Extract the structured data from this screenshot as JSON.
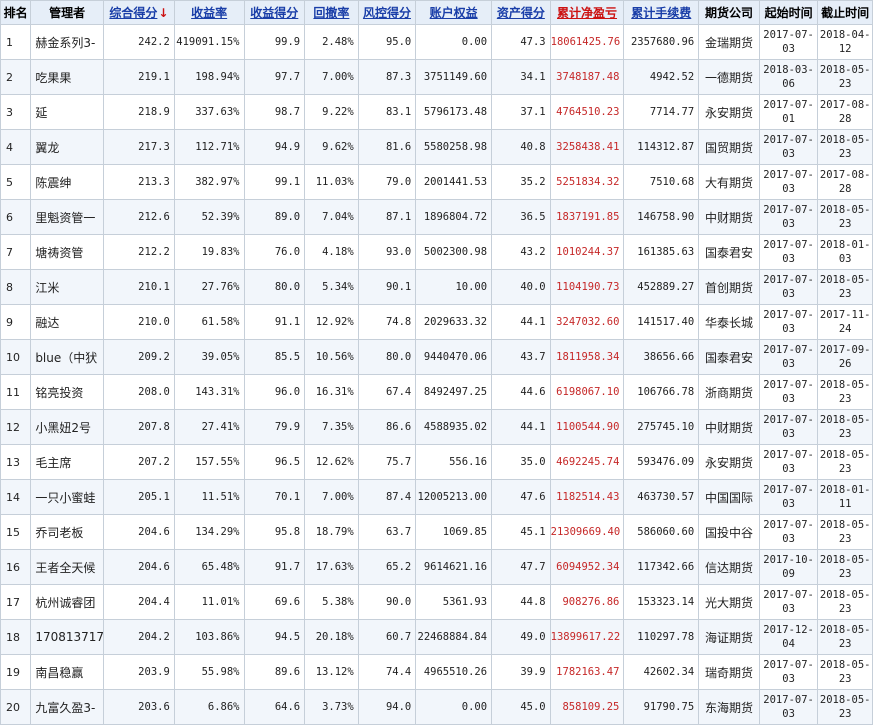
{
  "table": {
    "headers": [
      {
        "label": "排名",
        "link": false
      },
      {
        "label": "管理者",
        "link": false
      },
      {
        "label": "综合得分",
        "link": true,
        "sorted": true,
        "sort_icon": "↓"
      },
      {
        "label": "收益率",
        "link": true
      },
      {
        "label": "收益得分",
        "link": true
      },
      {
        "label": "回撤率",
        "link": true
      },
      {
        "label": "风控得分",
        "link": true
      },
      {
        "label": "账户权益",
        "link": true
      },
      {
        "label": "资产得分",
        "link": true
      },
      {
        "label": "累计净盈亏",
        "link": true,
        "color": "red"
      },
      {
        "label": "累计手续费",
        "link": true
      },
      {
        "label": "期货公司",
        "link": false
      },
      {
        "label": "起始时间",
        "link": false
      },
      {
        "label": "截止时间",
        "link": false
      }
    ],
    "rows": [
      {
        "rank": "1",
        "manager": "赫金系列3-",
        "score": "242.2",
        "return_rate": "419091.15%",
        "return_score": "99.9",
        "drawdown": "2.48%",
        "risk_score": "95.0",
        "equity": "0.00",
        "asset_score": "47.3",
        "net_profit": "18061425.76",
        "fees": "2357680.96",
        "company": "金瑞期货",
        "start_date": "2017-07-03",
        "end_date": "2018-04-12"
      },
      {
        "rank": "2",
        "manager": "吃果果",
        "score": "219.1",
        "return_rate": "198.94%",
        "return_score": "97.7",
        "drawdown": "7.00%",
        "risk_score": "87.3",
        "equity": "3751149.60",
        "asset_score": "34.1",
        "net_profit": "3748187.48",
        "fees": "4942.52",
        "company": "一德期货",
        "start_date": "2018-03-06",
        "end_date": "2018-05-23"
      },
      {
        "rank": "3",
        "manager": "延",
        "score": "218.9",
        "return_rate": "337.63%",
        "return_score": "98.7",
        "drawdown": "9.22%",
        "risk_score": "83.1",
        "equity": "5796173.48",
        "asset_score": "37.1",
        "net_profit": "4764510.23",
        "fees": "7714.77",
        "company": "永安期货",
        "start_date": "2017-07-01",
        "end_date": "2017-08-28"
      },
      {
        "rank": "4",
        "manager": "翼龙",
        "score": "217.3",
        "return_rate": "112.71%",
        "return_score": "94.9",
        "drawdown": "9.62%",
        "risk_score": "81.6",
        "equity": "5580258.98",
        "asset_score": "40.8",
        "net_profit": "3258438.41",
        "fees": "114312.87",
        "company": "国贸期货",
        "start_date": "2017-07-03",
        "end_date": "2018-05-23"
      },
      {
        "rank": "5",
        "manager": "陈震绅",
        "score": "213.3",
        "return_rate": "382.97%",
        "return_score": "99.1",
        "drawdown": "11.03%",
        "risk_score": "79.0",
        "equity": "2001441.53",
        "asset_score": "35.2",
        "net_profit": "5251834.32",
        "fees": "7510.68",
        "company": "大有期货",
        "start_date": "2017-07-03",
        "end_date": "2017-08-28"
      },
      {
        "rank": "6",
        "manager": "里魁资管一",
        "score": "212.6",
        "return_rate": "52.39%",
        "return_score": "89.0",
        "drawdown": "7.04%",
        "risk_score": "87.1",
        "equity": "1896804.72",
        "asset_score": "36.5",
        "net_profit": "1837191.85",
        "fees": "146758.90",
        "company": "中财期货",
        "start_date": "2017-07-03",
        "end_date": "2018-05-23"
      },
      {
        "rank": "7",
        "manager": "塘祷资管",
        "score": "212.2",
        "return_rate": "19.83%",
        "return_score": "76.0",
        "drawdown": "4.18%",
        "risk_score": "93.0",
        "equity": "5002300.98",
        "asset_score": "43.2",
        "net_profit": "1010244.37",
        "fees": "161385.63",
        "company": "国泰君安",
        "start_date": "2017-07-03",
        "end_date": "2018-01-03"
      },
      {
        "rank": "8",
        "manager": "江米",
        "score": "210.1",
        "return_rate": "27.76%",
        "return_score": "80.0",
        "drawdown": "5.34%",
        "risk_score": "90.1",
        "equity": "10.00",
        "asset_score": "40.0",
        "net_profit": "1104190.73",
        "fees": "452889.27",
        "company": "首创期货",
        "start_date": "2017-07-03",
        "end_date": "2018-05-23"
      },
      {
        "rank": "9",
        "manager": "融达",
        "score": "210.0",
        "return_rate": "61.58%",
        "return_score": "91.1",
        "drawdown": "12.92%",
        "risk_score": "74.8",
        "equity": "2029633.32",
        "asset_score": "44.1",
        "net_profit": "3247032.60",
        "fees": "141517.40",
        "company": "华泰长城",
        "start_date": "2017-07-03",
        "end_date": "2017-11-24"
      },
      {
        "rank": "10",
        "manager": "blue（中犾",
        "score": "209.2",
        "return_rate": "39.05%",
        "return_score": "85.5",
        "drawdown": "10.56%",
        "risk_score": "80.0",
        "equity": "9440470.06",
        "asset_score": "43.7",
        "net_profit": "1811958.34",
        "fees": "38656.66",
        "company": "国泰君安",
        "start_date": "2017-07-03",
        "end_date": "2017-09-26"
      },
      {
        "rank": "11",
        "manager": "铭亮投资",
        "score": "208.0",
        "return_rate": "143.31%",
        "return_score": "96.0",
        "drawdown": "16.31%",
        "risk_score": "67.4",
        "equity": "8492497.25",
        "asset_score": "44.6",
        "net_profit": "6198067.10",
        "fees": "106766.78",
        "company": "浙商期货",
        "start_date": "2017-07-03",
        "end_date": "2018-05-23"
      },
      {
        "rank": "12",
        "manager": "小黑妞2号",
        "score": "207.8",
        "return_rate": "27.41%",
        "return_score": "79.9",
        "drawdown": "7.35%",
        "risk_score": "86.6",
        "equity": "4588935.02",
        "asset_score": "44.1",
        "net_profit": "1100544.90",
        "fees": "275745.10",
        "company": "中财期货",
        "start_date": "2017-07-03",
        "end_date": "2018-05-23"
      },
      {
        "rank": "13",
        "manager": "毛主席",
        "score": "207.2",
        "return_rate": "157.55%",
        "return_score": "96.5",
        "drawdown": "12.62%",
        "risk_score": "75.7",
        "equity": "556.16",
        "asset_score": "35.0",
        "net_profit": "4692245.74",
        "fees": "593476.09",
        "company": "永安期货",
        "start_date": "2017-07-03",
        "end_date": "2018-05-23"
      },
      {
        "rank": "14",
        "manager": "一只小蜜蛙",
        "score": "205.1",
        "return_rate": "11.51%",
        "return_score": "70.1",
        "drawdown": "7.00%",
        "risk_score": "87.4",
        "equity": "12005213.00",
        "asset_score": "47.6",
        "net_profit": "1182514.43",
        "fees": "463730.57",
        "company": "中国国际",
        "start_date": "2017-07-03",
        "end_date": "2018-01-11"
      },
      {
        "rank": "15",
        "manager": "乔司老板",
        "score": "204.6",
        "return_rate": "134.29%",
        "return_score": "95.8",
        "drawdown": "18.79%",
        "risk_score": "63.7",
        "equity": "1069.85",
        "asset_score": "45.1",
        "net_profit": "21309669.40",
        "fees": "586060.60",
        "company": "国投中谷",
        "start_date": "2017-07-03",
        "end_date": "2018-05-23"
      },
      {
        "rank": "16",
        "manager": "王者全天候",
        "score": "204.6",
        "return_rate": "65.48%",
        "return_score": "91.7",
        "drawdown": "17.63%",
        "risk_score": "65.2",
        "equity": "9614621.16",
        "asset_score": "47.7",
        "net_profit": "6094952.34",
        "fees": "117342.66",
        "company": "信达期货",
        "start_date": "2017-10-09",
        "end_date": "2018-05-23"
      },
      {
        "rank": "17",
        "manager": "杭州诚睿团",
        "score": "204.4",
        "return_rate": "11.01%",
        "return_score": "69.6",
        "drawdown": "5.38%",
        "risk_score": "90.0",
        "equity": "5361.93",
        "asset_score": "44.8",
        "net_profit": "908276.86",
        "fees": "153323.14",
        "company": "光大期货",
        "start_date": "2017-07-03",
        "end_date": "2018-05-23"
      },
      {
        "rank": "18",
        "manager": "170813717:",
        "score": "204.2",
        "return_rate": "103.86%",
        "return_score": "94.5",
        "drawdown": "20.18%",
        "risk_score": "60.7",
        "equity": "22468884.84",
        "asset_score": "49.0",
        "net_profit": "13899617.22",
        "fees": "110297.78",
        "company": "海证期货",
        "start_date": "2017-12-04",
        "end_date": "2018-05-23"
      },
      {
        "rank": "19",
        "manager": "南昌稳赢",
        "score": "203.9",
        "return_rate": "55.98%",
        "return_score": "89.6",
        "drawdown": "13.12%",
        "risk_score": "74.4",
        "equity": "4965510.26",
        "asset_score": "39.9",
        "net_profit": "1782163.47",
        "fees": "42602.34",
        "company": "瑞奇期货",
        "start_date": "2017-07-03",
        "end_date": "2018-05-23"
      },
      {
        "rank": "20",
        "manager": "九富久盈3-",
        "score": "203.6",
        "return_rate": "6.86%",
        "return_score": "64.6",
        "drawdown": "3.73%",
        "risk_score": "94.0",
        "equity": "0.00",
        "asset_score": "45.0",
        "net_profit": "858109.25",
        "fees": "91790.75",
        "company": "东海期货",
        "start_date": "2017-07-03",
        "end_date": "2018-05-23"
      }
    ]
  },
  "colors": {
    "header_bg": "#e6eef8",
    "link_blue": "#1a3ea8",
    "profit_red": "#c62828",
    "border": "#c6cfd9",
    "alt_row": "#f2f6fb"
  }
}
